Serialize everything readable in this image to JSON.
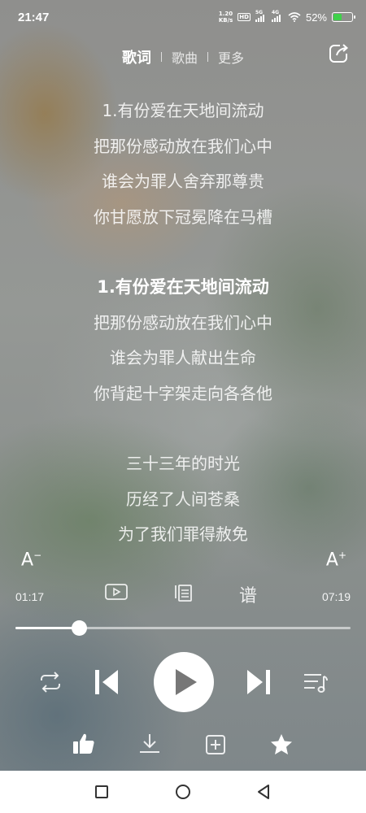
{
  "status_bar": {
    "time": "21:47",
    "net_speed_value": "1.20",
    "net_speed_unit": "KB/s",
    "hd_label": "HD",
    "signal_1_label": "5G",
    "signal_2_label": "4G",
    "battery_percent": "52%",
    "battery_level": 0.52,
    "battery_color": "#3fd14a"
  },
  "tabs": [
    {
      "label": "歌词",
      "active": true
    },
    {
      "label": "歌曲",
      "active": false
    },
    {
      "label": "更多",
      "active": false
    }
  ],
  "lyrics": {
    "block1": [
      "1.有份爱在天地间流动",
      "把那份感动放在我们心中",
      "谁会为罪人舍弃那尊贵",
      "你甘愿放下冠冕降在马槽"
    ],
    "block2": [
      "1.有份爱在天地间流动",
      "把那份感动放在我们心中",
      "谁会为罪人献出生命",
      "你背起十字架走向各各他"
    ],
    "block3": [
      "三十三年的时光",
      "历经了人间苍桑",
      "为了我们罪得赦免"
    ]
  },
  "font_controls": {
    "decrease": "A",
    "increase": "A",
    "decrease_mark": "−",
    "increase_mark": "+"
  },
  "playback": {
    "current_time": "01:17",
    "total_time": "07:19",
    "progress": 0.19,
    "score_label": "谱"
  },
  "icons": {
    "share": "share-icon",
    "video": "video-icon",
    "copy": "copy-icon",
    "repeat": "repeat-icon",
    "previous": "previous-icon",
    "play": "play-icon",
    "next": "next-icon",
    "playlist": "playlist-icon",
    "like": "like-icon",
    "download": "download-icon",
    "add": "add-icon",
    "favorite": "star-icon"
  },
  "nav_bar": [
    "recent-apps-icon",
    "home-icon",
    "back-icon"
  ]
}
